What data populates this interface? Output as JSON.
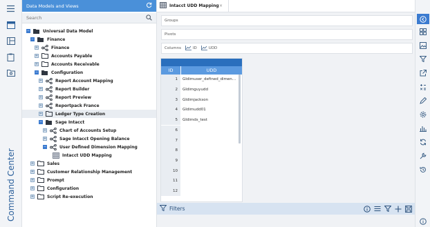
{
  "app": {
    "sidebar_title": "Command Center"
  },
  "tree_panel": {
    "title": "Data Models and Views",
    "search_placeholder": "Search",
    "items": [
      {
        "label": "Universal Data Model"
      },
      {
        "label": "Finance"
      },
      {
        "label": "Finance"
      },
      {
        "label": "Accounts Payable"
      },
      {
        "label": "Accounts Receivable"
      },
      {
        "label": "Configuration"
      },
      {
        "label": "Report Account Mapping"
      },
      {
        "label": "Report Builder"
      },
      {
        "label": "Report Preview"
      },
      {
        "label": "Reportpack France"
      },
      {
        "label": "Ledger Type Creation"
      },
      {
        "label": "Sage Intacct"
      },
      {
        "label": "Chart of Accounts Setup"
      },
      {
        "label": "Sage Intacct Opening Balance"
      },
      {
        "label": "User Defined Dimension Mapping"
      },
      {
        "label": "Intacct UDD Mapping"
      },
      {
        "label": "Sales"
      },
      {
        "label": "Customer Relationship Management"
      },
      {
        "label": "Prompt"
      },
      {
        "label": "Configuration"
      },
      {
        "label": "Script Re-execution"
      }
    ]
  },
  "tab": {
    "label": "Intacct UDD Mapping",
    "close": "×"
  },
  "sections": {
    "groups": "Groups",
    "pivots": "Pivots",
    "columns": "Columns"
  },
  "column_chips": [
    "ID",
    "UDD"
  ],
  "grid": {
    "headers": {
      "id": "ID",
      "udd": "UDD"
    },
    "rows": [
      {
        "id": "1",
        "udd": "GIdimuser_defined_dimensi..."
      },
      {
        "id": "2",
        "udd": "GIdimguyudd"
      },
      {
        "id": "3",
        "udd": "GIdimjackson"
      },
      {
        "id": "4",
        "udd": "GIdimudd01"
      },
      {
        "id": "5",
        "udd": "GIdimds_test"
      },
      {
        "id": "6",
        "udd": ""
      },
      {
        "id": "7",
        "udd": ""
      },
      {
        "id": "8",
        "udd": ""
      },
      {
        "id": "9",
        "udd": ""
      },
      {
        "id": "10",
        "udd": ""
      },
      {
        "id": "11",
        "udd": ""
      },
      {
        "id": "12",
        "udd": ""
      }
    ]
  },
  "filters": {
    "label": "Filters"
  },
  "colors": {
    "accent": "#4a90d9",
    "grid_header": "#5b9ae0",
    "filter_bar": "#d7e3f1"
  }
}
